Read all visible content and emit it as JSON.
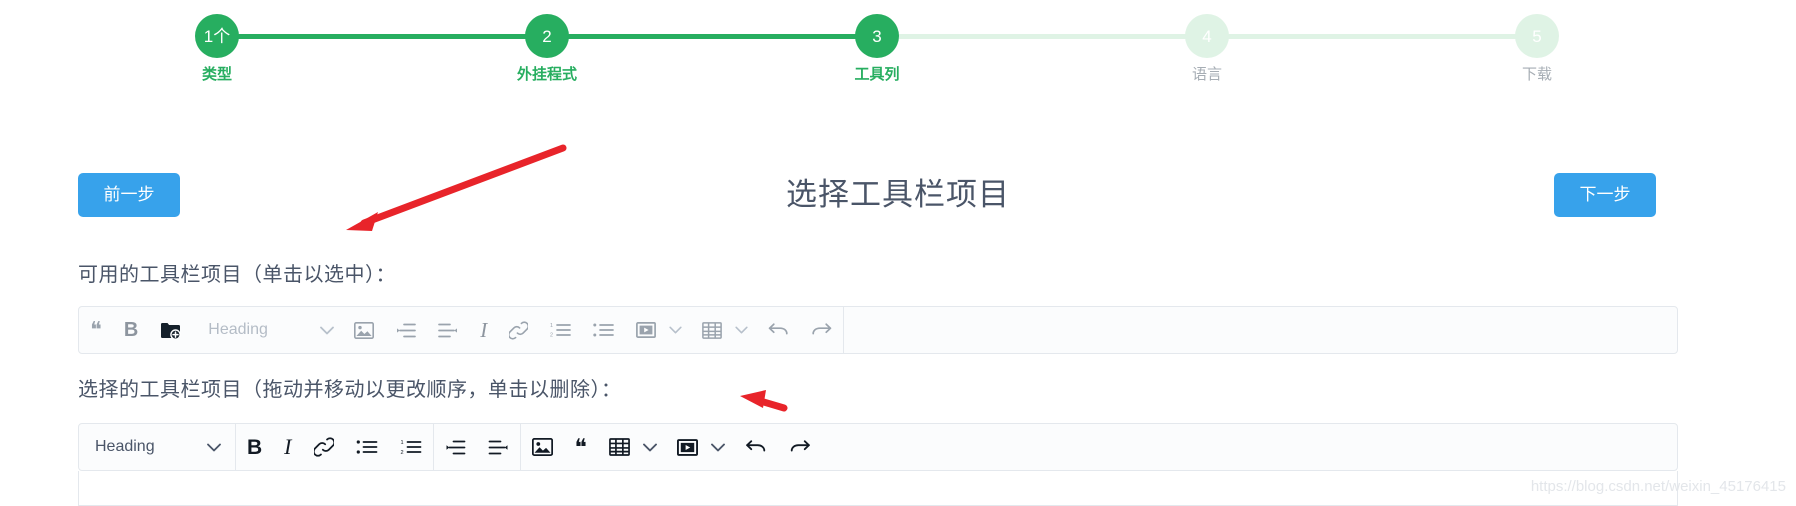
{
  "stepper": {
    "steps": [
      {
        "num": "1个",
        "label": "类型",
        "state": "done"
      },
      {
        "num": "2",
        "label": "外挂程式",
        "state": "done"
      },
      {
        "num": "3",
        "label": "工具列",
        "state": "current"
      },
      {
        "num": "4",
        "label": "语言",
        "state": "todo"
      },
      {
        "num": "5",
        "label": "下载",
        "state": "todo"
      }
    ],
    "active_color": "#27ae60",
    "inactive_color": "#dff3e5",
    "inactive_text_color": "#a6adb4"
  },
  "nav": {
    "prev_label": "前一步",
    "next_label": "下一步",
    "button_color": "#37a2eb"
  },
  "page_title": "选择工具栏项目",
  "available": {
    "label": "可用的工具栏项目（单击以选中）：",
    "heading_value": "Heading",
    "items": [
      {
        "name": "blockquote-icon",
        "glyph": "❝"
      },
      {
        "name": "bold-icon",
        "glyph": "B"
      },
      {
        "name": "folder-add-icon",
        "glyph": "folder-add"
      },
      {
        "name": "heading-select",
        "glyph": "Heading"
      },
      {
        "name": "image-icon",
        "glyph": "image"
      },
      {
        "name": "indent-icon",
        "glyph": "indent"
      },
      {
        "name": "outdent-icon",
        "glyph": "outdent"
      },
      {
        "name": "italic-icon",
        "glyph": "I"
      },
      {
        "name": "link-icon",
        "glyph": "link"
      },
      {
        "name": "ordered-list-icon",
        "glyph": "ordered-list"
      },
      {
        "name": "bullet-list-icon",
        "glyph": "bullet-list"
      },
      {
        "name": "video-icon",
        "glyph": "video"
      },
      {
        "name": "table-icon",
        "glyph": "table"
      },
      {
        "name": "undo-icon",
        "glyph": "undo"
      },
      {
        "name": "redo-icon",
        "glyph": "redo"
      }
    ]
  },
  "selected": {
    "label": "选择的工具栏项目（拖动并移动以更改顺序，单击以删除）：",
    "heading_value": "Heading",
    "items": [
      {
        "name": "bold-icon",
        "glyph": "B"
      },
      {
        "name": "italic-icon",
        "glyph": "I"
      },
      {
        "name": "link-icon",
        "glyph": "link"
      },
      {
        "name": "bullet-list-icon",
        "glyph": "bullet-list"
      },
      {
        "name": "ordered-list-icon",
        "glyph": "ordered-list"
      },
      {
        "name": "indent-icon",
        "glyph": "indent"
      },
      {
        "name": "outdent-icon",
        "glyph": "outdent"
      },
      {
        "name": "image-icon",
        "glyph": "image"
      },
      {
        "name": "blockquote-icon",
        "glyph": "❝"
      },
      {
        "name": "table-icon",
        "glyph": "table"
      },
      {
        "name": "video-icon",
        "glyph": "video"
      },
      {
        "name": "undo-icon",
        "glyph": "undo"
      },
      {
        "name": "redo-icon",
        "glyph": "redo"
      }
    ]
  },
  "annotations": {
    "arrow_color": "#e8242a",
    "arrow_count": 2
  },
  "watermark": "https://blog.csdn.net/weixin_45176415"
}
